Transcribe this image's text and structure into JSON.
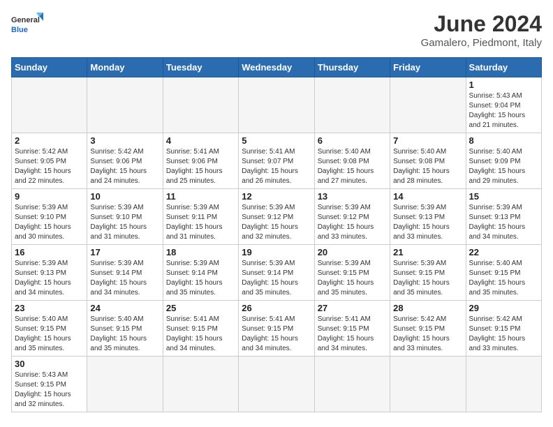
{
  "logo": {
    "text_general": "General",
    "text_blue": "Blue"
  },
  "title": "June 2024",
  "subtitle": "Gamalero, Piedmont, Italy",
  "headers": [
    "Sunday",
    "Monday",
    "Tuesday",
    "Wednesday",
    "Thursday",
    "Friday",
    "Saturday"
  ],
  "weeks": [
    [
      {
        "day": "",
        "info": ""
      },
      {
        "day": "",
        "info": ""
      },
      {
        "day": "",
        "info": ""
      },
      {
        "day": "",
        "info": ""
      },
      {
        "day": "",
        "info": ""
      },
      {
        "day": "",
        "info": ""
      },
      {
        "day": "1",
        "info": "Sunrise: 5:43 AM\nSunset: 9:04 PM\nDaylight: 15 hours and 21 minutes."
      }
    ],
    [
      {
        "day": "2",
        "info": "Sunrise: 5:42 AM\nSunset: 9:05 PM\nDaylight: 15 hours and 22 minutes."
      },
      {
        "day": "3",
        "info": "Sunrise: 5:42 AM\nSunset: 9:06 PM\nDaylight: 15 hours and 24 minutes."
      },
      {
        "day": "4",
        "info": "Sunrise: 5:41 AM\nSunset: 9:06 PM\nDaylight: 15 hours and 25 minutes."
      },
      {
        "day": "5",
        "info": "Sunrise: 5:41 AM\nSunset: 9:07 PM\nDaylight: 15 hours and 26 minutes."
      },
      {
        "day": "6",
        "info": "Sunrise: 5:40 AM\nSunset: 9:08 PM\nDaylight: 15 hours and 27 minutes."
      },
      {
        "day": "7",
        "info": "Sunrise: 5:40 AM\nSunset: 9:08 PM\nDaylight: 15 hours and 28 minutes."
      },
      {
        "day": "8",
        "info": "Sunrise: 5:40 AM\nSunset: 9:09 PM\nDaylight: 15 hours and 29 minutes."
      }
    ],
    [
      {
        "day": "9",
        "info": "Sunrise: 5:39 AM\nSunset: 9:10 PM\nDaylight: 15 hours and 30 minutes."
      },
      {
        "day": "10",
        "info": "Sunrise: 5:39 AM\nSunset: 9:10 PM\nDaylight: 15 hours and 31 minutes."
      },
      {
        "day": "11",
        "info": "Sunrise: 5:39 AM\nSunset: 9:11 PM\nDaylight: 15 hours and 31 minutes."
      },
      {
        "day": "12",
        "info": "Sunrise: 5:39 AM\nSunset: 9:12 PM\nDaylight: 15 hours and 32 minutes."
      },
      {
        "day": "13",
        "info": "Sunrise: 5:39 AM\nSunset: 9:12 PM\nDaylight: 15 hours and 33 minutes."
      },
      {
        "day": "14",
        "info": "Sunrise: 5:39 AM\nSunset: 9:13 PM\nDaylight: 15 hours and 33 minutes."
      },
      {
        "day": "15",
        "info": "Sunrise: 5:39 AM\nSunset: 9:13 PM\nDaylight: 15 hours and 34 minutes."
      }
    ],
    [
      {
        "day": "16",
        "info": "Sunrise: 5:39 AM\nSunset: 9:13 PM\nDaylight: 15 hours and 34 minutes."
      },
      {
        "day": "17",
        "info": "Sunrise: 5:39 AM\nSunset: 9:14 PM\nDaylight: 15 hours and 34 minutes."
      },
      {
        "day": "18",
        "info": "Sunrise: 5:39 AM\nSunset: 9:14 PM\nDaylight: 15 hours and 35 minutes."
      },
      {
        "day": "19",
        "info": "Sunrise: 5:39 AM\nSunset: 9:14 PM\nDaylight: 15 hours and 35 minutes."
      },
      {
        "day": "20",
        "info": "Sunrise: 5:39 AM\nSunset: 9:15 PM\nDaylight: 15 hours and 35 minutes."
      },
      {
        "day": "21",
        "info": "Sunrise: 5:39 AM\nSunset: 9:15 PM\nDaylight: 15 hours and 35 minutes."
      },
      {
        "day": "22",
        "info": "Sunrise: 5:40 AM\nSunset: 9:15 PM\nDaylight: 15 hours and 35 minutes."
      }
    ],
    [
      {
        "day": "23",
        "info": "Sunrise: 5:40 AM\nSunset: 9:15 PM\nDaylight: 15 hours and 35 minutes."
      },
      {
        "day": "24",
        "info": "Sunrise: 5:40 AM\nSunset: 9:15 PM\nDaylight: 15 hours and 35 minutes."
      },
      {
        "day": "25",
        "info": "Sunrise: 5:41 AM\nSunset: 9:15 PM\nDaylight: 15 hours and 34 minutes."
      },
      {
        "day": "26",
        "info": "Sunrise: 5:41 AM\nSunset: 9:15 PM\nDaylight: 15 hours and 34 minutes."
      },
      {
        "day": "27",
        "info": "Sunrise: 5:41 AM\nSunset: 9:15 PM\nDaylight: 15 hours and 34 minutes."
      },
      {
        "day": "28",
        "info": "Sunrise: 5:42 AM\nSunset: 9:15 PM\nDaylight: 15 hours and 33 minutes."
      },
      {
        "day": "29",
        "info": "Sunrise: 5:42 AM\nSunset: 9:15 PM\nDaylight: 15 hours and 33 minutes."
      }
    ],
    [
      {
        "day": "30",
        "info": "Sunrise: 5:43 AM\nSunset: 9:15 PM\nDaylight: 15 hours and 32 minutes."
      },
      {
        "day": "",
        "info": ""
      },
      {
        "day": "",
        "info": ""
      },
      {
        "day": "",
        "info": ""
      },
      {
        "day": "",
        "info": ""
      },
      {
        "day": "",
        "info": ""
      },
      {
        "day": "",
        "info": ""
      }
    ]
  ]
}
